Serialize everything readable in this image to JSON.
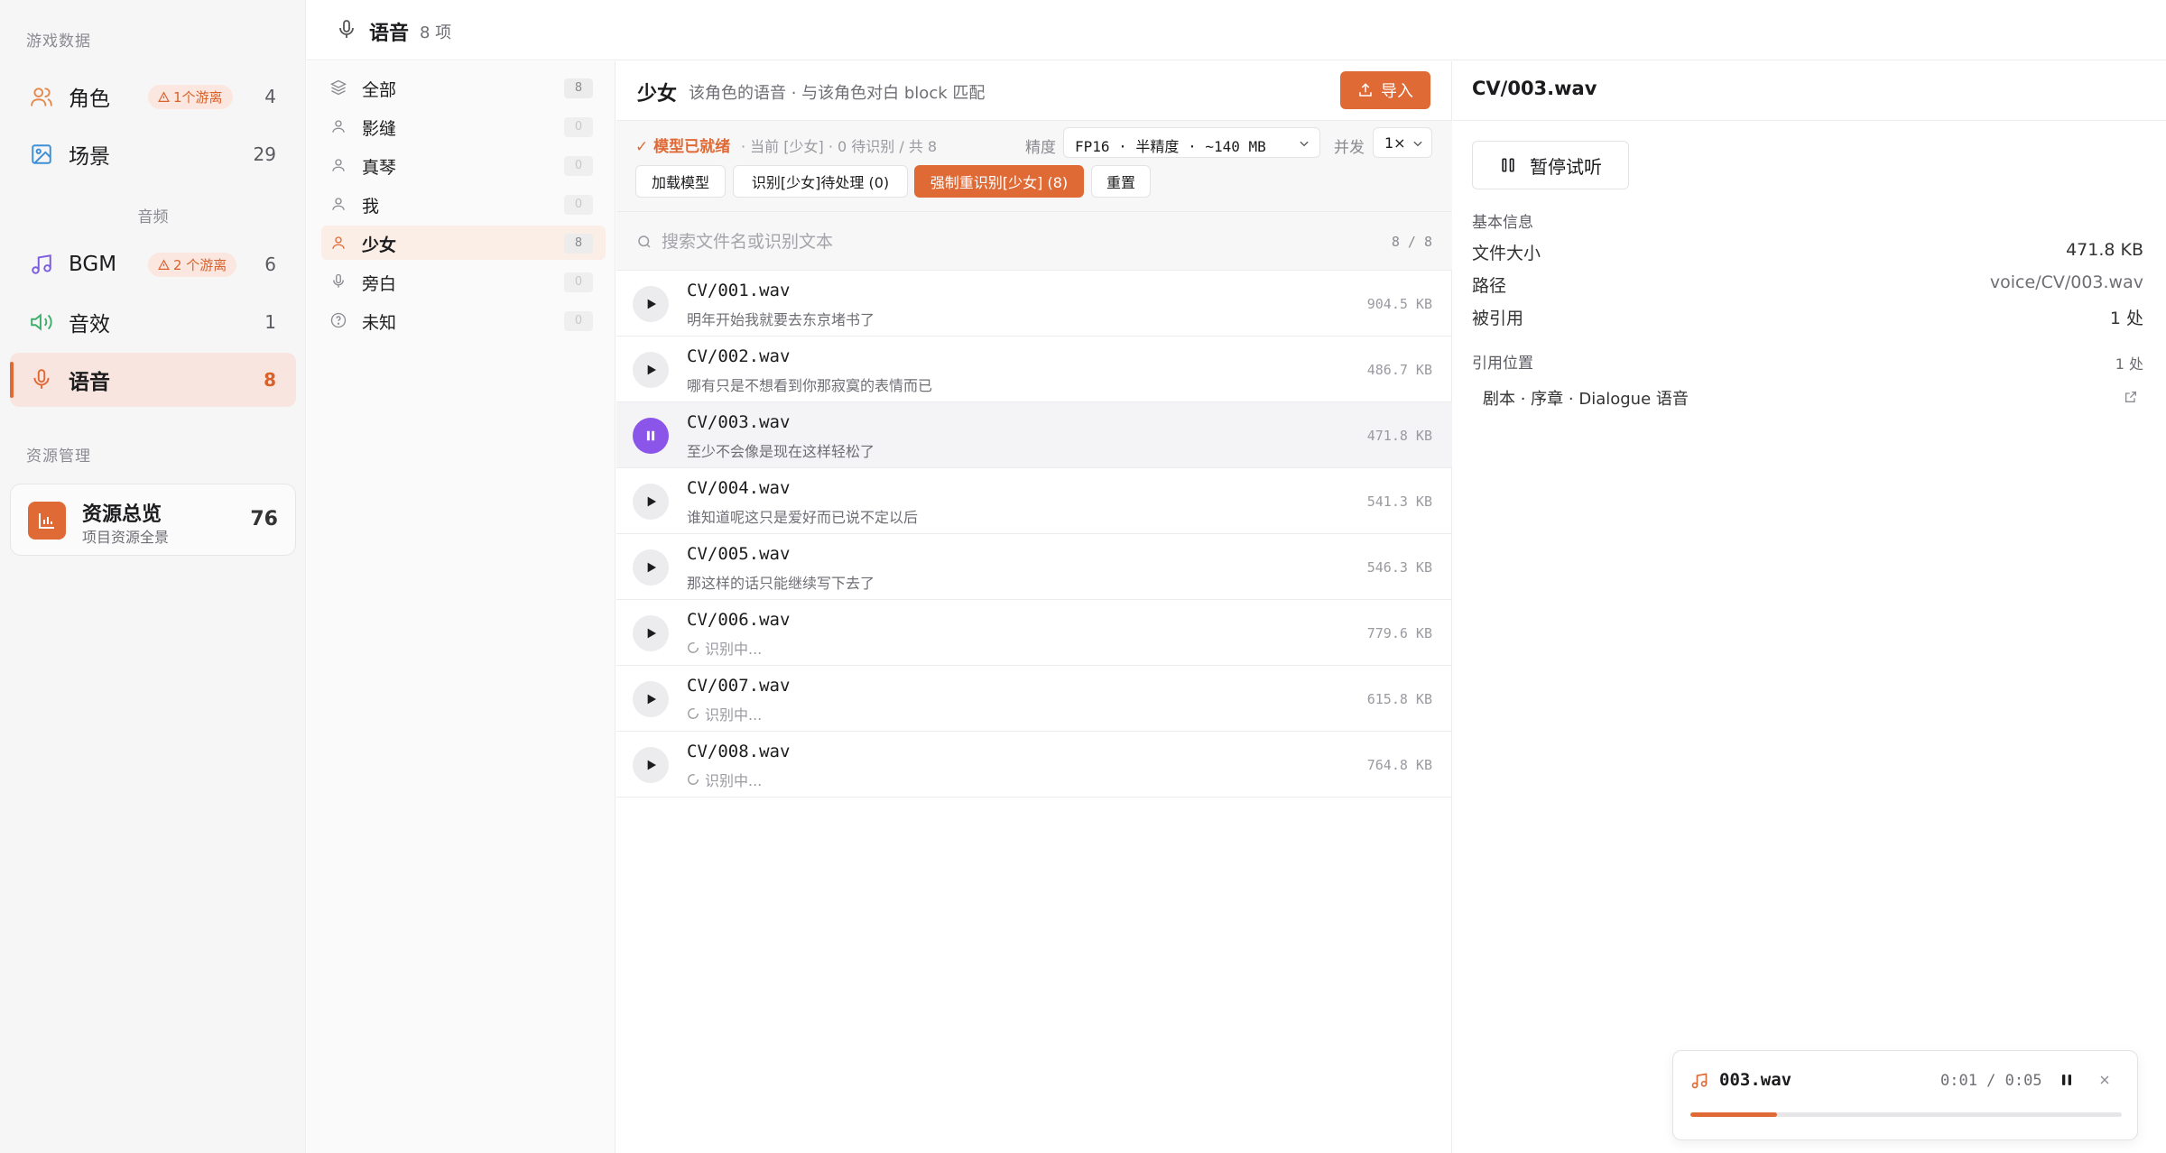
{
  "sidebar": {
    "section_game": "游戏数据",
    "items_game": [
      {
        "label": "角色",
        "badge": "1个游离",
        "count": "4"
      },
      {
        "label": "场景",
        "count": "29"
      }
    ],
    "section_audio": "音频",
    "items_audio": [
      {
        "label": "BGM",
        "badge": "2 个游离",
        "count": "6"
      },
      {
        "label": "音效",
        "count": "1"
      },
      {
        "label": "语音",
        "count": "8"
      }
    ],
    "section_resource": "资源管理",
    "overview": {
      "title": "资源总览",
      "subtitle": "项目资源全景",
      "count": "76"
    }
  },
  "header": {
    "title": "语音",
    "count": "8 项"
  },
  "characters": [
    {
      "label": "全部",
      "count": "8",
      "icon": "layers-icon"
    },
    {
      "label": "影缝",
      "count": "0",
      "icon": "user-icon"
    },
    {
      "label": "真琴",
      "count": "0",
      "icon": "user-icon"
    },
    {
      "label": "我",
      "count": "0",
      "icon": "user-icon"
    },
    {
      "label": "少女",
      "count": "8",
      "icon": "user-icon"
    },
    {
      "label": "旁白",
      "count": "0",
      "icon": "mic-icon"
    },
    {
      "label": "未知",
      "count": "0",
      "icon": "help-circle-icon"
    }
  ],
  "main": {
    "title": "少女",
    "description": "该角色的语音 · 与该角色对白 block 匹配",
    "import_label": "导入",
    "status_ready": "✓ 模型已就绪",
    "status_info": "· 当前 [少女] · 0 待识别 / 共 8",
    "precision_label": "精度",
    "precision_value": "FP16 · 半精度 · ~140 MB",
    "concurrency_label": "并发",
    "concurrency_value": "1×",
    "buttons": {
      "load_model": "加载模型",
      "recognize_pending": "识别[少女]待处理 (0)",
      "force_recognize": "强制重识别[少女] (8)",
      "reset": "重置"
    },
    "search_placeholder": "搜索文件名或识别文本",
    "search_count": "8 / 8",
    "files": [
      {
        "name": "CV/001.wav",
        "text": "明年开始我就要去东京堵书了",
        "size": "904.5 KB",
        "state": "idle"
      },
      {
        "name": "CV/002.wav",
        "text": "哪有只是不想看到你那寂寞的表情而已",
        "size": "486.7 KB",
        "state": "idle"
      },
      {
        "name": "CV/003.wav",
        "text": "至少不会像是现在这样轻松了",
        "size": "471.8 KB",
        "state": "playing"
      },
      {
        "name": "CV/004.wav",
        "text": "谁知道呢这只是爱好而已说不定以后",
        "size": "541.3 KB",
        "state": "idle"
      },
      {
        "name": "CV/005.wav",
        "text": "那这样的话只能继续写下去了",
        "size": "546.3 KB",
        "state": "idle"
      },
      {
        "name": "CV/006.wav",
        "text": "识别中...",
        "size": "779.6 KB",
        "state": "pending"
      },
      {
        "name": "CV/007.wav",
        "text": "识别中...",
        "size": "615.8 KB",
        "state": "pending"
      },
      {
        "name": "CV/008.wav",
        "text": "识别中...",
        "size": "764.8 KB",
        "state": "pending"
      }
    ]
  },
  "detail": {
    "title": "CV/003.wav",
    "pause_label": "暂停试听",
    "basic_info": "基本信息",
    "file_size_label": "文件大小",
    "file_size": "471.8 KB",
    "path_label": "路径",
    "path": "voice/CV/003.wav",
    "refs_label": "被引用",
    "refs": "1 处",
    "ref_locations_label": "引用位置",
    "ref_locations_count": "1 处",
    "ref_item": "剧本 · 序章 · Dialogue 语音"
  },
  "player": {
    "name": "003.wav",
    "time": "0:01 / 0:05",
    "progress": 0.2
  },
  "colors": {
    "accent": "#e06a35",
    "playing": "#8a55e8",
    "active_bg": "#f8e5e0"
  }
}
